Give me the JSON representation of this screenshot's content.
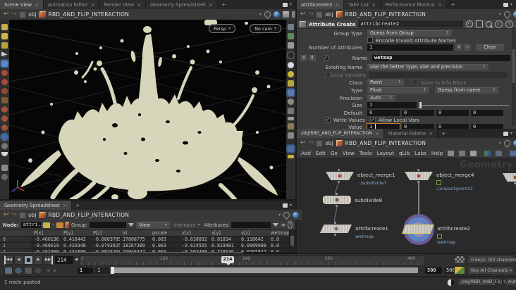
{
  "glyphs": {
    "close": "×",
    "plus": "+",
    "down": "▾",
    "up": "▴",
    "check": "✓",
    "back": "↩",
    "fwd": "↪",
    "tostart": "◀◀",
    "rplay": "◀",
    "stop": "■",
    "play": "▶",
    "toend": "▶▶",
    "nudge_l": "◀",
    "nudge_r": "▶",
    "list": "≡",
    "info": "i",
    "help": "?",
    "refresh": "↻",
    "updown": "↕"
  },
  "breadcrumb": {
    "context": "obj",
    "node": "RBD_AND_FLIP_INTERACTION"
  },
  "scene": {
    "tabs": [
      "Scene View",
      "Animation Editor",
      "Render View",
      "Geometry Spreadsheet"
    ],
    "persp": "Persp",
    "cam": "No cam"
  },
  "params": {
    "tabs": [
      "attribcreate2",
      "Take List",
      "Performance Monitor"
    ],
    "type_label": "Attribute Create",
    "node_name": "attribcreate2",
    "group_type_label": "Group Type",
    "group_type_value": "Guess from Group",
    "encode_label": "Encode Invalid Attribute Names",
    "num_label": "Number of Attributes",
    "num_value": "1",
    "plus": "+",
    "minus": "−",
    "clear": "Clear",
    "name_label": "Name",
    "name_value": "wetmap",
    "existing_label": "Existing Name",
    "existing_value": "Use the better type, size and precision",
    "localvar_label": "Local Variable",
    "class_label": "Class",
    "class_value": "Point",
    "saveinfo_label": "Save to Info Block",
    "type_row_label": "Type",
    "type_value": "Float",
    "guess_value": "Guess from name",
    "precision_label": "Precision",
    "precision_value": "Auto",
    "size_label": "Size",
    "size_value": "1",
    "default_label": "Default",
    "default_values": [
      "0",
      "0",
      "0",
      "0"
    ],
    "write_label": "Write Values",
    "allow_label": "Allow Local Vars",
    "value_label": "Value",
    "value_values": [
      "1",
      "0",
      "0",
      "0"
    ]
  },
  "network": {
    "tabs": [
      "/obj/RBD_AND_FLIP_INTERACTION",
      "Material Palette"
    ],
    "menus": [
      "Add",
      "Edit",
      "Go",
      "View",
      "Tools",
      "Layout",
      "qLib",
      "Labs",
      "Help"
    ],
    "watermark": "Geometry",
    "nodes": [
      {
        "name": "object_merge1",
        "comment": "../subdivide7"
      },
      {
        "name": "object_merge4",
        "comment": "../unpackpoints1"
      },
      {
        "name": "subdivide8",
        "comment": ""
      },
      {
        "name": "attribcreate1",
        "comment": "wetmap"
      },
      {
        "name": "attribcreate2",
        "comment": "wetmap"
      }
    ]
  },
  "spreadsheet": {
    "tabs": [
      "Geometry Spreadsheet"
    ],
    "toolbar": {
      "node_label": "Node:",
      "node_value": "attri...",
      "group_label": "Group:",
      "view_label": "View",
      "intrinsics_label": "Intrinsics",
      "attributes_label": "Attributes:"
    },
    "columns": [
      "P[x]",
      "P[y]",
      "P[z]",
      "id",
      "pscale",
      "v[x]",
      "v[y]",
      "v[z]",
      "wetmap"
    ],
    "rows": [
      {
        "index": "0",
        "cells": [
          "-0.460136",
          "0.418442",
          "-0.0803785",
          "37808775",
          "0.003",
          "-0.638892",
          "0.81834",
          "0.118642",
          "0.0"
        ]
      },
      {
        "index": "1",
        "cells": [
          "-0.460619",
          "0.420348",
          "-0.0793925",
          "18267389",
          "0.003",
          "-0.614555",
          "0.819481",
          "0.0989998",
          "0.0"
        ]
      },
      {
        "index": "2",
        "cells": [
          "-0.461009",
          "0.431899",
          "-0.0826268",
          "25046347",
          "0.003",
          "-0.502409",
          "0.728536",
          "0.0265822",
          "0.0"
        ]
      }
    ]
  },
  "timeline": {
    "frame": "214",
    "playhead": "214",
    "ticks": [
      "1",
      "120",
      "240",
      "360",
      "480"
    ],
    "start1": "1",
    "start2": "1",
    "end1": "500",
    "end2": "500",
    "keys": "0 keys, 0/0 channels",
    "keyall": "Key All Channels"
  },
  "status": {
    "message": "1 node pasted",
    "context_path": "/obj/RBD_AND_F...",
    "update_mode": "Auto Update"
  },
  "colors": {
    "accent_orange": "#c8832e",
    "splash": "#d8d6ba",
    "comment_blue": "#7fa7cd",
    "badge_green": "#77a43d",
    "select_purple": "#6b5a93",
    "select_blue": "#5d83c3"
  }
}
